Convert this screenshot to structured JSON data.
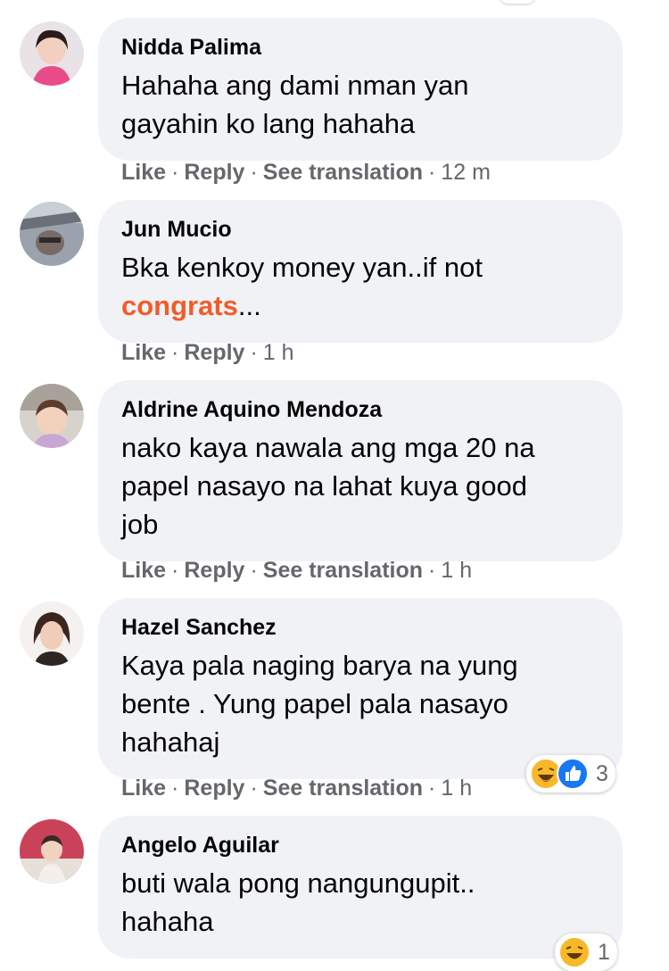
{
  "comments": [
    {
      "author": "Nidda Palima",
      "text_line1": "Hahaha ang dami nman yan",
      "text_line2": "gayahin ko lang hahaha",
      "actions": {
        "like": "Like",
        "reply": "Reply",
        "translate": "See translation",
        "time": "12 m"
      }
    },
    {
      "author": "Jun Mucio",
      "text_line1": "Bka kenkoy money yan..if not",
      "mention": "congrats",
      "mention_suffix": "...",
      "actions": {
        "like": "Like",
        "reply": "Reply",
        "time": "1 h"
      }
    },
    {
      "author": "Aldrine Aquino Mendoza",
      "text_line1": "nako kaya nawala ang mga 20 na",
      "text_line2": "papel nasayo na lahat kuya good",
      "text_line3": "job",
      "actions": {
        "like": "Like",
        "reply": "Reply",
        "translate": "See translation",
        "time": "1 h"
      }
    },
    {
      "author": "Hazel Sanchez",
      "text_line1": "Kaya pala naging barya na yung",
      "text_line2": "bente . Yung papel pala nasayo",
      "text_line3": "hahahaj",
      "actions": {
        "like": "Like",
        "reply": "Reply",
        "translate": "See translation",
        "time": "1 h"
      },
      "reactions": {
        "icons": [
          "haha-icon",
          "like-icon"
        ],
        "count": "3"
      }
    },
    {
      "author": "Angelo Aguilar",
      "text_line1": "buti wala pong nangungupit..",
      "text_line2": "hahaha",
      "reactions": {
        "icons": [
          "haha-icon"
        ],
        "count": "1"
      }
    }
  ],
  "separator": "·",
  "colors": {
    "bubble": "#f0f2f5",
    "meta": "#65676b",
    "mention": "#f25c2a",
    "like_blue": "#1877f2",
    "haha_yellow": "#f7b928"
  }
}
